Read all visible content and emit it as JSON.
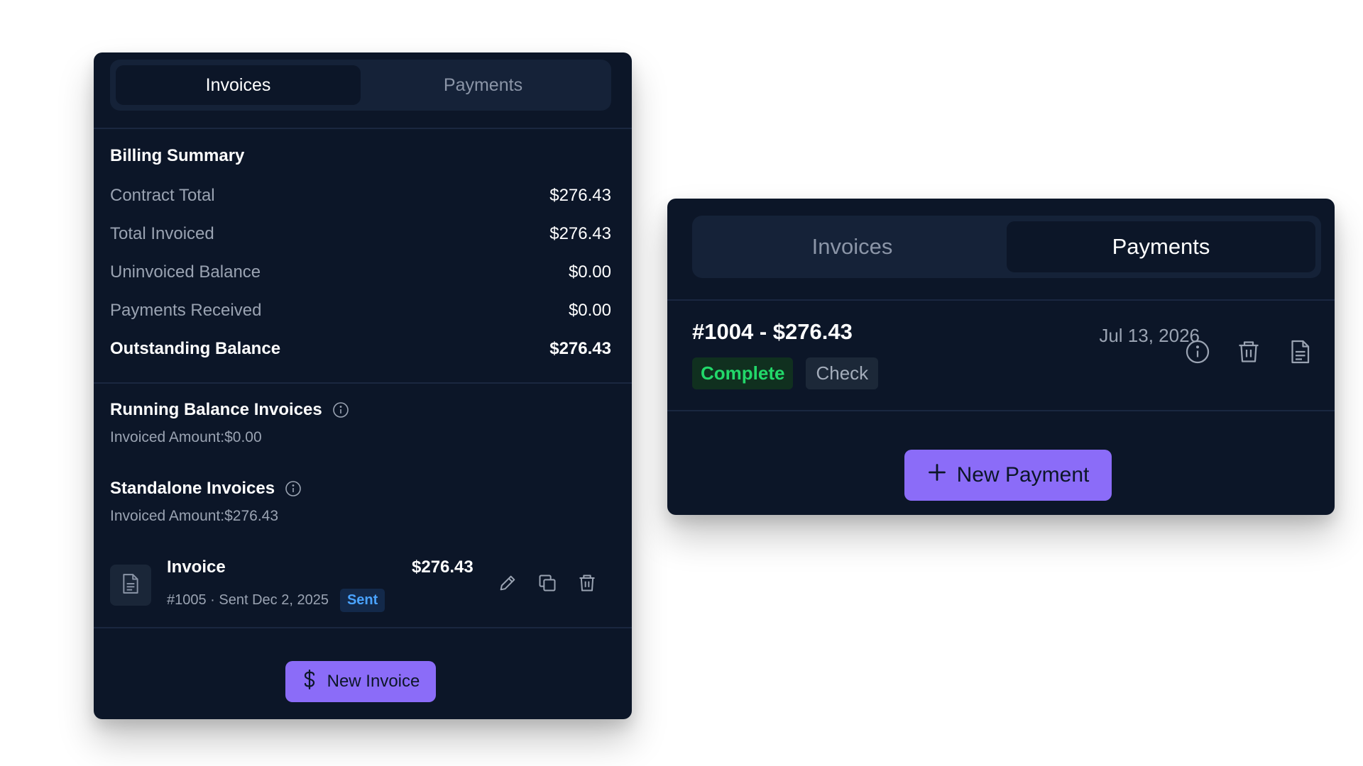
{
  "invoices_card": {
    "tabs": [
      {
        "label": "Invoices",
        "active": true
      },
      {
        "label": "Payments",
        "active": false
      }
    ],
    "billing_summary": {
      "title": "Billing Summary",
      "rows": [
        {
          "label": "Contract Total",
          "value": "$276.43"
        },
        {
          "label": "Total Invoiced",
          "value": "$276.43"
        },
        {
          "label": "Uninvoiced Balance",
          "value": "$0.00"
        },
        {
          "label": "Payments Received",
          "value": "$0.00"
        },
        {
          "label": "Outstanding Balance",
          "value": "$276.43"
        }
      ]
    },
    "running_balance": {
      "title": "Running Balance Invoices",
      "amount": "Invoiced Amount:$0.00"
    },
    "standalone": {
      "title": "Standalone Invoices",
      "amount": "Invoiced Amount:$276.43"
    },
    "invoice": {
      "title": "Invoice",
      "amount": "$276.43",
      "meta": "#1005 · Sent Dec 2, 2025",
      "status": "Sent"
    },
    "new_invoice_label": "New Invoice"
  },
  "payments_card": {
    "tabs": [
      {
        "label": "Invoices",
        "active": false
      },
      {
        "label": "Payments",
        "active": true
      }
    ],
    "payment": {
      "title": "#1004 - $276.43",
      "date": "Jul 13, 2026",
      "status": "Complete",
      "method": "Check"
    },
    "new_payment_label": "New Payment"
  },
  "colors": {
    "card_bg": "#0c1628",
    "accent": "#8b6cf8",
    "sent_badge": "#4aa3ff",
    "complete_badge": "#22d86a"
  },
  "icons": [
    "info-icon",
    "document-icon",
    "edit-icon",
    "copy-icon",
    "trash-icon",
    "dollar-icon",
    "plus-icon"
  ]
}
